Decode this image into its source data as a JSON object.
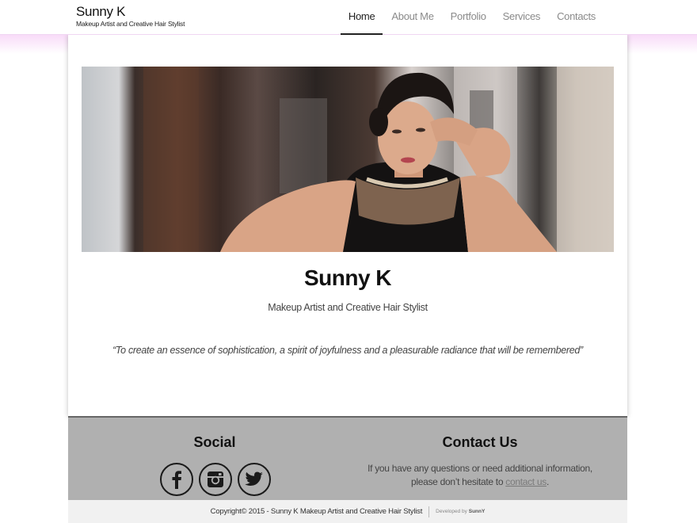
{
  "brand": {
    "name": "Sunny K",
    "tagline": "Makeup Artist and Creative Hair Stylist"
  },
  "nav": [
    {
      "label": "Home",
      "active": true
    },
    {
      "label": "About Me",
      "active": false
    },
    {
      "label": "Portfolio",
      "active": false
    },
    {
      "label": "Services",
      "active": false
    },
    {
      "label": "Contacts",
      "active": false
    }
  ],
  "hero": {
    "title": "Sunny K",
    "subtitle": "Makeup Artist and Creative Hair Stylist",
    "quote": "“To create an essence of sophistication, a spirit of joyfulness and a pleasurable radiance that will be remembered”"
  },
  "footer": {
    "social_title": "Social",
    "social_icons": [
      "facebook-icon",
      "instagram-icon",
      "twitter-icon"
    ],
    "contact_title": "Contact Us",
    "contact_text": "If you have any questions or need additional information, please don’t hesitate to ",
    "contact_link": "contact us",
    "contact_end": "."
  },
  "bottom": {
    "copyright": "Copyright© 2015 - Sunny K Makeup Artist and Creative Hair Stylist",
    "developed_by": "Developed by",
    "developer": "SunnY"
  },
  "colors": {
    "accent_pink": "#f8dbf8",
    "footer_bg": "#b0b0b0",
    "bottom_bg": "#f1f1f1"
  }
}
